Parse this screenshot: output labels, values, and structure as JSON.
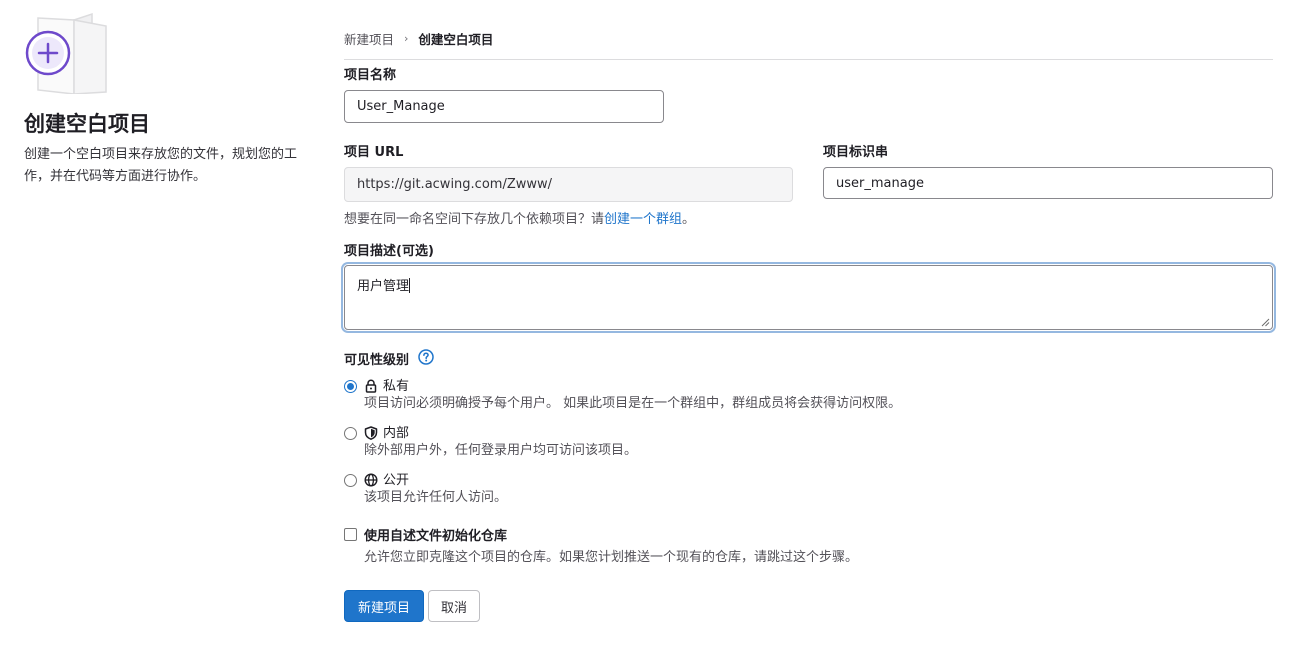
{
  "sidebar": {
    "title": "创建空白项目",
    "description": "创建一个空白项目来存放您的文件，规划您的工作，并在代码等方面进行协作。"
  },
  "breadcrumb": {
    "parent": "新建项目",
    "separator": "›",
    "current": "创建空白项目"
  },
  "form": {
    "project_name": {
      "label": "项目名称",
      "value": "User_Manage"
    },
    "project_url": {
      "label": "项目 URL",
      "value": "https://git.acwing.com/Zwww/"
    },
    "project_slug": {
      "label": "项目标识串",
      "value": "user_manage"
    },
    "group_hint": {
      "text": "想要在同一命名空间下存放几个依赖项目？请",
      "link": "创建一个群组",
      "suffix": "。"
    },
    "description": {
      "label": "项目描述(可选)",
      "value": "用户管理"
    },
    "visibility": {
      "label": "可见性级别",
      "options": [
        {
          "title": "私有",
          "desc": "项目访问必须明确授予每个用户。 如果此项目是在一个群组中，群组成员将会获得访问权限。",
          "icon": "lock-icon",
          "checked": true
        },
        {
          "title": "内部",
          "desc": "除外部用户外，任何登录用户均可访问该项目。",
          "icon": "shield-icon",
          "checked": false
        },
        {
          "title": "公开",
          "desc": "该项目允许任何人访问。",
          "icon": "globe-icon",
          "checked": false
        }
      ]
    },
    "readme": {
      "label": "使用自述文件初始化仓库",
      "desc": "允许您立即克隆这个项目的仓库。如果您计划推送一个现有的仓库，请跳过这个步骤。",
      "checked": false
    },
    "submit_label": "新建项目",
    "cancel_label": "取消"
  },
  "colors": {
    "primary": "#1f75cb",
    "accent_purple": "#6e49cb"
  }
}
